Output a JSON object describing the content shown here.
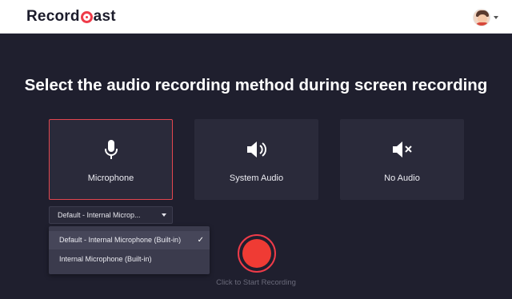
{
  "header": {
    "brand_left": "Record",
    "brand_right": "ast"
  },
  "title": "Select the audio recording method during screen recording",
  "methods": [
    {
      "label": "Microphone",
      "icon": "microphone-icon",
      "selected": true
    },
    {
      "label": "System Audio",
      "icon": "speaker-icon",
      "selected": false
    },
    {
      "label": "No Audio",
      "icon": "speaker-muted-icon",
      "selected": false
    }
  ],
  "mic_select": {
    "value": "Default - Internal Microp...",
    "options": [
      {
        "label": "Default - Internal Microphone (Built-in)",
        "checked": true
      },
      {
        "label": "Internal Microphone (Built-in)",
        "checked": false
      }
    ]
  },
  "record": {
    "caption": "Click to Start Recording"
  },
  "colors": {
    "background": "#1f1f2e",
    "card": "#2a2a3a",
    "accent": "#ef3b49"
  }
}
